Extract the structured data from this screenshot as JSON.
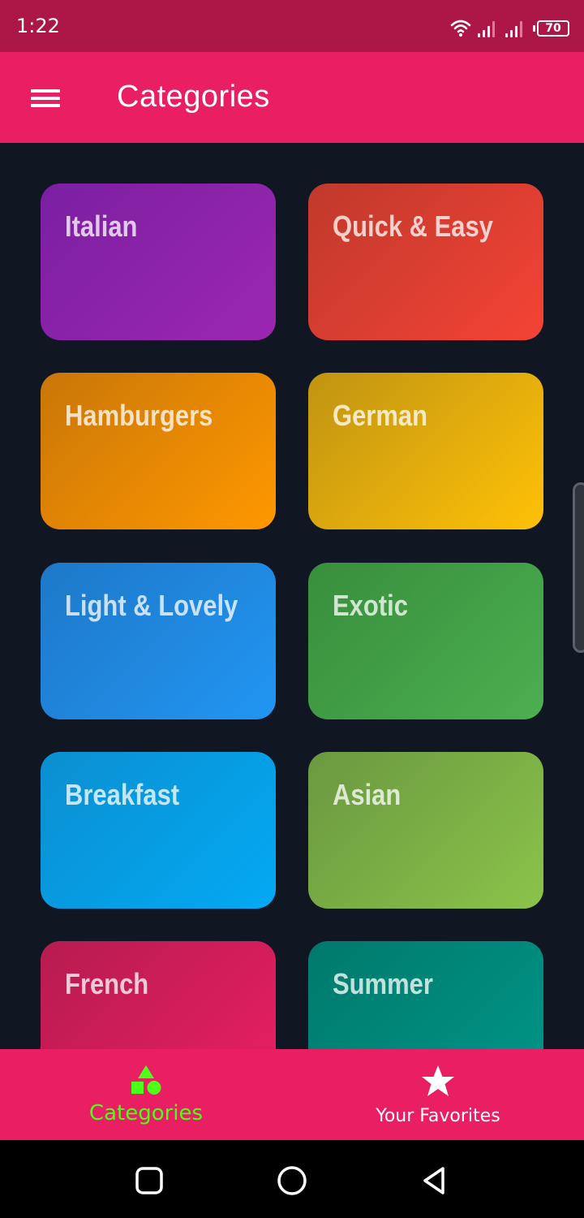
{
  "status_bar": {
    "time": "1:22",
    "battery": "70",
    "icons": [
      "wifi-icon",
      "signal-icon",
      "signal-icon",
      "battery-icon"
    ]
  },
  "app_bar": {
    "title": "Categories",
    "menu_icon": "hamburger-menu-icon"
  },
  "categories": [
    {
      "label": "Italian",
      "color_from": "#7b1fa2",
      "color_to": "#9c27b0"
    },
    {
      "label": "Quick & Easy",
      "color_from": "#c0392b",
      "color_to": "#f44336"
    },
    {
      "label": "Hamburgers",
      "color_from": "#c97608",
      "color_to": "#ff9800"
    },
    {
      "label": "German",
      "color_from": "#c09412",
      "color_to": "#ffc107"
    },
    {
      "label": "Light & Lovely",
      "color_from": "#1e78c8",
      "color_to": "#2196f3"
    },
    {
      "label": "Exotic",
      "color_from": "#388e3c",
      "color_to": "#4caf50"
    },
    {
      "label": "Breakfast",
      "color_from": "#0b8fd0",
      "color_to": "#03a9f4"
    },
    {
      "label": "Asian",
      "color_from": "#6a9840",
      "color_to": "#8bc34a"
    },
    {
      "label": "French",
      "color_from": "#b71c50",
      "color_to": "#e91e63"
    },
    {
      "label": "Summer",
      "color_from": "#00796b",
      "color_to": "#009688"
    }
  ],
  "bottom_nav": {
    "items": [
      {
        "label": "Categories",
        "icon": "category-shapes-icon",
        "active": true
      },
      {
        "label": "Your Favorites",
        "icon": "star-icon",
        "active": false
      }
    ]
  },
  "system_nav": {
    "icons": [
      "recents-square-icon",
      "home-circle-icon",
      "back-triangle-icon"
    ]
  },
  "colors": {
    "primary": "#e91e63",
    "status_bar": "#ad1747",
    "background": "#101722",
    "active_nav": "#4cff19"
  }
}
